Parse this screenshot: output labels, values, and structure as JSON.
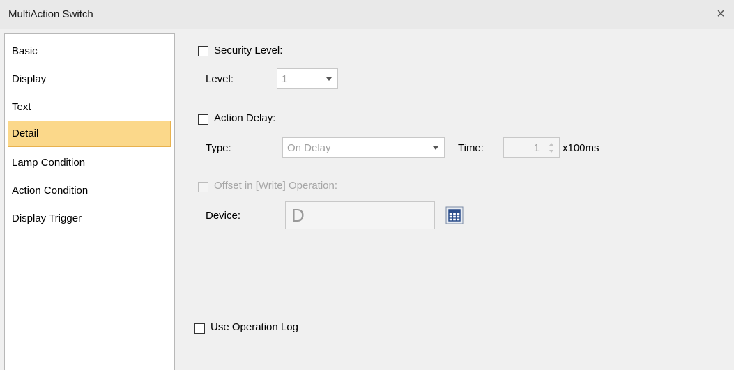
{
  "window": {
    "title": "MultiAction Switch",
    "close_glyph": "×"
  },
  "sidebar": {
    "items": [
      {
        "label": "Basic",
        "selected": false
      },
      {
        "label": "Display",
        "selected": false
      },
      {
        "label": "Text",
        "selected": false
      },
      {
        "label": "Detail",
        "selected": true
      },
      {
        "label": "Lamp Condition",
        "selected": false
      },
      {
        "label": "Action Condition",
        "selected": false
      },
      {
        "label": "Display Trigger",
        "selected": false
      }
    ]
  },
  "security": {
    "checkbox_label": "Security Level:",
    "checked": false,
    "level_label": "Level:",
    "level_value": "1"
  },
  "action_delay": {
    "checkbox_label": "Action Delay:",
    "checked": false,
    "type_label": "Type:",
    "type_value": "On Delay",
    "time_label": "Time:",
    "time_value": "1",
    "time_unit": "x100ms"
  },
  "offset": {
    "checkbox_label": "Offset in [Write] Operation:",
    "checked": false,
    "enabled": false,
    "device_label": "Device:",
    "device_value": "D",
    "device_button_icon": "tag-browser-icon"
  },
  "operation_log": {
    "checkbox_label": "Use Operation Log",
    "checked": false
  },
  "colors": {
    "selection_fill": "#fbd88a",
    "selection_border": "#e8b24e",
    "disabled_text": "#a6a6a6"
  }
}
